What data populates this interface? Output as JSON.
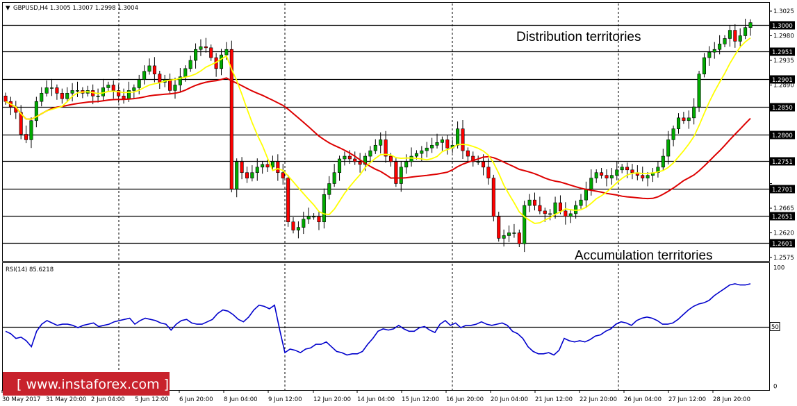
{
  "header": {
    "arrow": "▼",
    "text": "GBPUSD,H4  1.3005 1.3007 1.2998 1.3004"
  },
  "annotations": {
    "top": "Distribution territories",
    "bottom": "Accumulation territories"
  },
  "watermark": "[ www.instaforex.com ]",
  "colors": {
    "bull": "#00aa00",
    "bear": "#ff0000",
    "ma_fast": "#ffff00",
    "ma_slow": "#dd0000",
    "rsi": "#0000cc",
    "watermark_bg": "#c8222c"
  },
  "chart_data": [
    {
      "type": "candlestick",
      "title": "GBPUSD,H4",
      "ylim": [
        1.2575,
        1.3025
      ],
      "price_ticks": [
        "1.3025",
        "1.2980",
        "1.2935",
        "1.2890",
        "1.2845",
        "1.2800",
        "1.2755",
        "1.2710",
        "1.2665",
        "1.2620",
        "1.2575"
      ],
      "levels": [
        {
          "value": 1.3,
          "label": "1.3000"
        },
        {
          "value": 1.2951,
          "label": "1.2951"
        },
        {
          "value": 1.2901,
          "label": "1.2901"
        },
        {
          "value": 1.285,
          "label": "1.2850"
        },
        {
          "value": 1.28,
          "label": "1.2800"
        },
        {
          "value": 1.2751,
          "label": "1.2751"
        },
        {
          "value": 1.2701,
          "label": "1.2701"
        },
        {
          "value": 1.2651,
          "label": "1.2651"
        },
        {
          "value": 1.2601,
          "label": "1.2601"
        }
      ],
      "x_labels": [
        "30 May 2017",
        "31 May 20:00",
        "2 Jun 04:00",
        "5 Jun 12:00",
        "6 Jun 20:00",
        "8 Jun 04:00",
        "9 Jun 12:00",
        "12 Jun 20:00",
        "14 Jun 04:00",
        "15 Jun 12:00",
        "16 Jun 20:00",
        "20 Jun 04:00",
        "21 Jun 12:00",
        "22 Jun 20:00",
        "26 Jun 04:00",
        "27 Jun 12:00",
        "28 Jun 20:00"
      ],
      "closes": [
        1.286,
        1.285,
        1.284,
        1.28,
        1.279,
        1.2825,
        1.286,
        1.2875,
        1.2885,
        1.2885,
        1.2875,
        1.2865,
        1.2875,
        1.288,
        1.288,
        1.2875,
        1.288,
        1.287,
        1.287,
        1.2885,
        1.289,
        1.288,
        1.287,
        1.2865,
        1.288,
        1.2885,
        1.29,
        1.2915,
        1.2925,
        1.291,
        1.2895,
        1.29,
        1.288,
        1.289,
        1.2905,
        1.292,
        1.2935,
        1.2955,
        1.296,
        1.2958,
        1.294,
        1.292,
        1.2945,
        1.2955,
        1.27,
        1.275,
        1.273,
        1.272,
        1.273,
        1.274,
        1.2745,
        1.274,
        1.275,
        1.273,
        1.272,
        1.264,
        1.2625,
        1.263,
        1.2645,
        1.265,
        1.265,
        1.264,
        1.269,
        1.271,
        1.273,
        1.2755,
        1.276,
        1.2755,
        1.275,
        1.2745,
        1.276,
        1.277,
        1.278,
        1.279,
        1.276,
        1.275,
        1.271,
        1.274,
        1.275,
        1.276,
        1.2765,
        1.277,
        1.2775,
        1.278,
        1.2785,
        1.279,
        1.2775,
        1.278,
        1.281,
        1.277,
        1.276,
        1.275,
        1.275,
        1.274,
        1.272,
        1.265,
        1.261,
        1.2615,
        1.262,
        1.262,
        1.26,
        1.267,
        1.268,
        1.267,
        1.266,
        1.2655,
        1.2655,
        1.2675,
        1.266,
        1.265,
        1.2655,
        1.267,
        1.268,
        1.27,
        1.272,
        1.273,
        1.2725,
        1.272,
        1.2725,
        1.2735,
        1.274,
        1.2735,
        1.273,
        1.2725,
        1.272,
        1.2725,
        1.273,
        1.274,
        1.276,
        1.279,
        1.281,
        1.283,
        1.2825,
        1.283,
        1.285,
        1.291,
        1.294,
        1.295,
        1.2955,
        1.2965,
        1.2975,
        1.299,
        1.297,
        1.298,
        1.2995,
        1.3004
      ]
    },
    {
      "type": "line",
      "title": "RSI(14) 85.6218",
      "ylim": [
        0,
        100
      ],
      "ticks": [
        "100",
        "50",
        "0"
      ],
      "level": 50,
      "values": [
        46,
        44,
        40,
        41,
        38,
        33,
        46,
        52,
        55,
        53,
        51,
        52,
        52,
        51,
        49,
        51,
        52,
        53,
        50,
        51,
        52,
        54,
        55,
        56,
        57,
        52,
        55,
        57,
        56,
        55,
        53,
        52,
        47,
        52,
        55,
        56,
        53,
        52,
        52,
        54,
        56,
        61,
        64,
        63,
        60,
        56,
        54,
        58,
        64,
        68,
        67,
        65,
        68,
        47,
        28,
        31,
        30,
        28,
        31,
        32,
        35,
        35,
        37,
        33,
        29,
        28,
        26,
        27,
        27,
        29,
        35,
        40,
        46,
        48,
        47,
        48,
        51,
        48,
        46,
        46,
        49,
        50,
        47,
        45,
        52,
        55,
        51,
        53,
        49,
        51,
        51,
        52,
        54,
        52,
        51,
        52,
        53,
        51,
        46,
        44,
        40,
        33,
        29,
        27,
        27,
        28,
        26,
        30,
        40,
        38,
        37,
        38,
        37,
        39,
        42,
        43,
        46,
        48,
        52,
        54,
        53,
        51,
        55,
        57,
        58,
        57,
        55,
        52,
        52,
        53,
        56,
        60,
        64,
        67,
        69,
        70,
        72,
        76,
        79,
        82,
        85,
        86,
        85,
        85,
        86
      ]
    }
  ]
}
